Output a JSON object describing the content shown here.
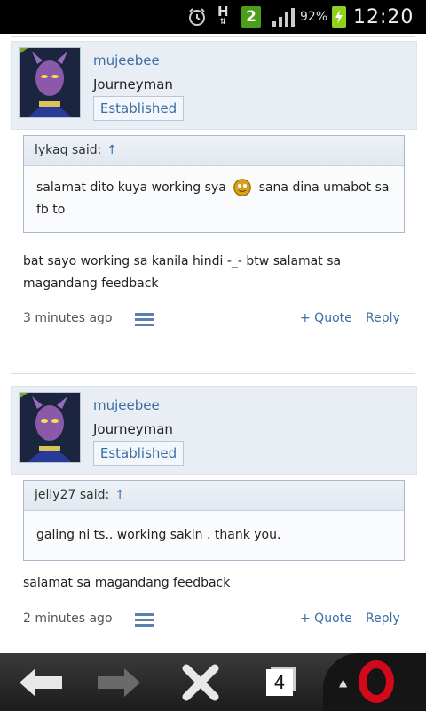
{
  "status_bar": {
    "network_type": "H",
    "notification_count": "2",
    "battery_percent": "92%",
    "time": "12:20"
  },
  "posts": [
    {
      "username": "mujeebee",
      "user_title": "Journeyman",
      "badge": "Established",
      "quote_author": "lykaq said:",
      "quote_arrow": "↑",
      "quote_text_before": "salamat dito kuya working sya",
      "quote_text_after": "sana dina umabot sa fb to",
      "message": "bat sayo working sa kanila hindi -_- btw salamat sa magandang feedback",
      "time": "3 minutes ago",
      "quote_label": "+ Quote",
      "reply_label": "Reply"
    },
    {
      "username": "mujeebee",
      "user_title": "Journeyman",
      "badge": "Established",
      "quote_author": "jelly27 said:",
      "quote_arrow": "↑",
      "quote_text": "galing ni ts.. working sakin . thank you.",
      "message": "salamat sa magandang feedback",
      "time": "2 minutes ago",
      "quote_label": "+ Quote",
      "reply_label": "Reply"
    }
  ],
  "nav": {
    "tab_count": "4"
  },
  "colors": {
    "link": "#3a6ea5",
    "header_bg": "#e9eef4",
    "opera_red": "#d3091b"
  }
}
